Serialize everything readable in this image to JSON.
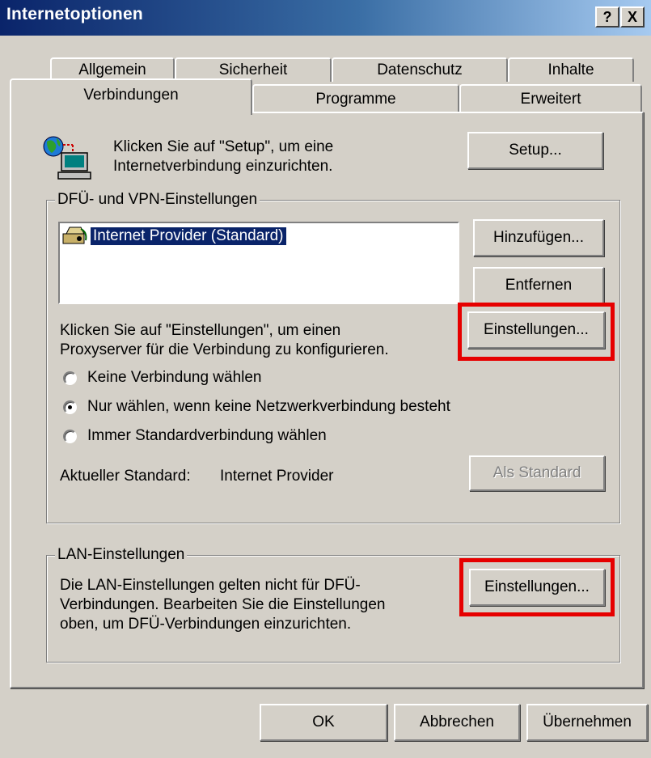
{
  "window": {
    "title": "Internetoptionen",
    "help_label": "?",
    "close_label": "X"
  },
  "tabs": {
    "row_back": [
      "Allgemein",
      "Sicherheit",
      "Datenschutz",
      "Inhalte"
    ],
    "row_front": [
      "Verbindungen",
      "Programme",
      "Erweitert"
    ],
    "active": "Verbindungen"
  },
  "setup": {
    "text_line1": "Klicken Sie auf \"Setup\", um eine",
    "text_line2": "Internetverbindung einzurichten.",
    "button": "Setup..."
  },
  "dialup": {
    "legend": "DFÜ- und VPN-Einstellungen",
    "connections": [
      {
        "name": "Internet Provider (Standard)",
        "selected": true
      }
    ],
    "add_button": "Hinzufügen...",
    "remove_button": "Entfernen",
    "proxy_text_line1": "Klicken Sie auf \"Einstellungen\", um einen",
    "proxy_text_line2": "Proxyserver für die Verbindung zu konfigurieren.",
    "settings_button": "Einstellungen...",
    "radio_never": "Keine Verbindung wählen",
    "radio_when_no_network": "Nur wählen, wenn keine Netzwerkverbindung besteht",
    "radio_always": "Immer Standardverbindung wählen",
    "selected_radio": "radio_when_no_network",
    "current_default_label": "Aktueller Standard:",
    "current_default_value": "Internet Provider",
    "set_default_button": "Als Standard"
  },
  "lan": {
    "legend": "LAN-Einstellungen",
    "text_line1": "Die LAN-Einstellungen gelten nicht für DFÜ-",
    "text_line2": "Verbindungen. Bearbeiten Sie die Einstellungen",
    "text_line3": "oben, um DFÜ-Verbindungen einzurichten.",
    "settings_button": "Einstellungen..."
  },
  "footer": {
    "ok": "OK",
    "cancel": "Abbrechen",
    "apply": "Übernehmen"
  },
  "colors": {
    "highlight_box": "#e60000",
    "selection": "#0a246a",
    "face": "#d4d0c8"
  }
}
